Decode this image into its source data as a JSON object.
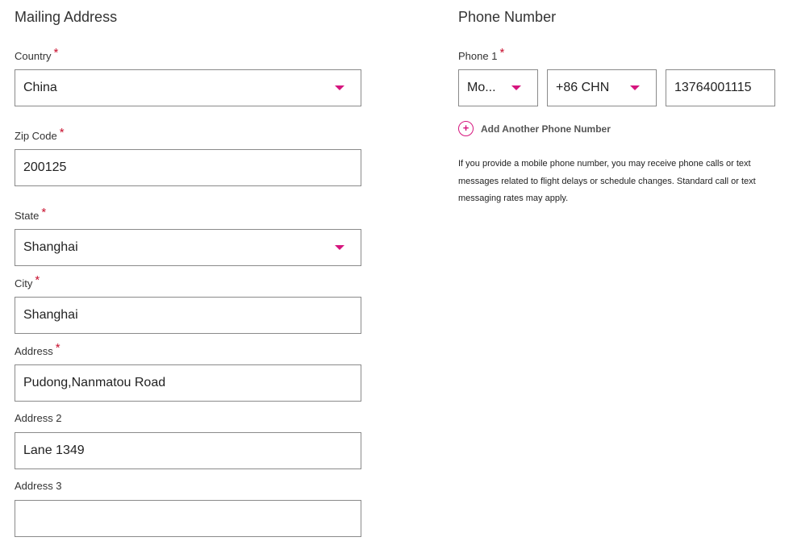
{
  "mailing": {
    "title": "Mailing Address",
    "country": {
      "label": "Country",
      "value": "China"
    },
    "zip": {
      "label": "Zip Code",
      "value": "200125"
    },
    "state": {
      "label": "State",
      "value": "Shanghai"
    },
    "city": {
      "label": "City",
      "value": "Shanghai"
    },
    "address": {
      "label": "Address",
      "value": "Pudong,Nanmatou Road"
    },
    "address2": {
      "label": "Address 2",
      "value": "Lane 1349"
    },
    "address3": {
      "label": "Address 3",
      "value": ""
    }
  },
  "phone": {
    "title": "Phone Number",
    "phone1": {
      "label": "Phone 1",
      "type_value": "Mo...",
      "country_code_value": "+86 CHN",
      "number_value": "13764001115"
    },
    "add_icon": "+",
    "add_label": "Add Another Phone Number",
    "note": "If you provide a mobile phone number, you may receive phone calls or text messages related to flight delays or schedule changes. Standard call or text messaging rates may apply."
  },
  "required_marker": "*",
  "colors": {
    "accent": "#d6157e",
    "required": "#c8102e",
    "border": "#8a8a8a"
  },
  "icons": {
    "dropdown": "chevron-down-icon",
    "add": "plus-circle-icon"
  }
}
